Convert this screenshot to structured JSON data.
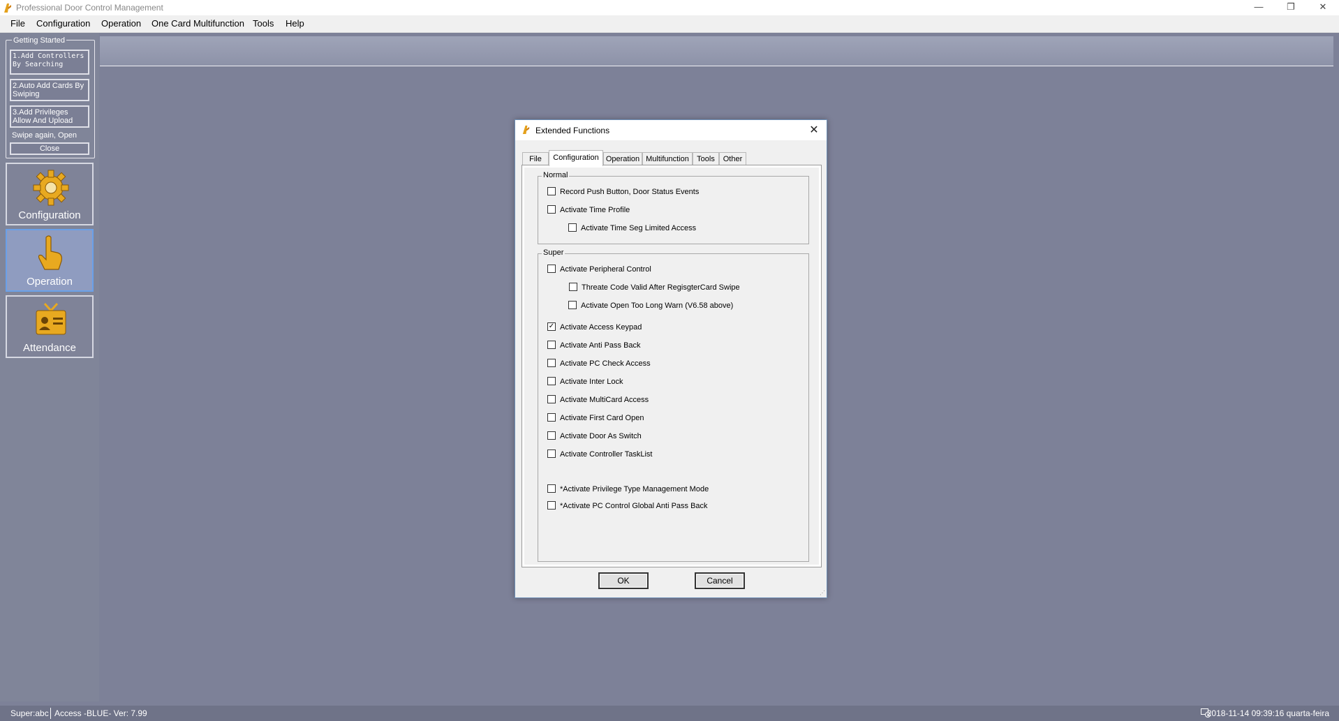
{
  "window": {
    "title": "Professional Door Control Management",
    "minimize_glyph": "—",
    "restore_glyph": "❐",
    "close_glyph": "✕"
  },
  "menu": [
    "File",
    "Configuration",
    "Operation",
    "One Card Multifunction",
    "Tools",
    "Help"
  ],
  "getting_started": {
    "legend": "Getting Started",
    "step1": "1.Add Controllers By Searching",
    "step2": "2.Auto Add Cards By Swiping",
    "step3": "3.Add Privileges Allow And Upload",
    "note": "Swipe again, Open",
    "close": "Close"
  },
  "nav": {
    "configuration": "Configuration",
    "operation": "Operation",
    "attendance": "Attendance",
    "selected": "Operation"
  },
  "statusbar": {
    "user": "Super:abc",
    "version": "Access -BLUE- Ver: 7.99",
    "datetime": "2018-11-14 09:39:16 quarta-feira"
  },
  "dialog": {
    "title": "Extended Functions",
    "close_glyph": "✕",
    "tabs": [
      "File",
      "Configuration",
      "Operation",
      "Multifunction",
      "Tools",
      "Other"
    ],
    "active_tab": "Configuration",
    "normal": {
      "legend": "Normal",
      "items": [
        {
          "label": "Record Push Button, Door Status Events",
          "checked": false
        },
        {
          "label": "Activate Time Profile",
          "checked": false
        },
        {
          "label": "Activate Time Seg Limited Access",
          "checked": false
        }
      ]
    },
    "super": {
      "legend": "Super",
      "items": [
        {
          "label": "Activate Peripheral Control",
          "checked": false
        },
        {
          "label": "Threate Code Valid After RegisgterCard Swipe",
          "checked": false
        },
        {
          "label": "Activate Open Too Long Warn (V6.58 above)",
          "checked": false
        },
        {
          "label": "Activate Access Keypad",
          "checked": true
        },
        {
          "label": "Activate Anti Pass Back",
          "checked": false
        },
        {
          "label": "Activate PC Check Access",
          "checked": false
        },
        {
          "label": "Activate Inter Lock",
          "checked": false
        },
        {
          "label": "Activate MultiCard Access",
          "checked": false
        },
        {
          "label": "Activate First Card Open",
          "checked": false
        },
        {
          "label": "Activate Door As Switch",
          "checked": false
        },
        {
          "label": "Activate Controller TaskList",
          "checked": false
        },
        {
          "label": "*Activate Privilege Type Management Mode",
          "checked": false
        },
        {
          "label": "*Activate PC Control Global Anti Pass Back",
          "checked": false
        }
      ]
    },
    "ok": "OK",
    "cancel": "Cancel",
    "check_glyph": "✓"
  }
}
